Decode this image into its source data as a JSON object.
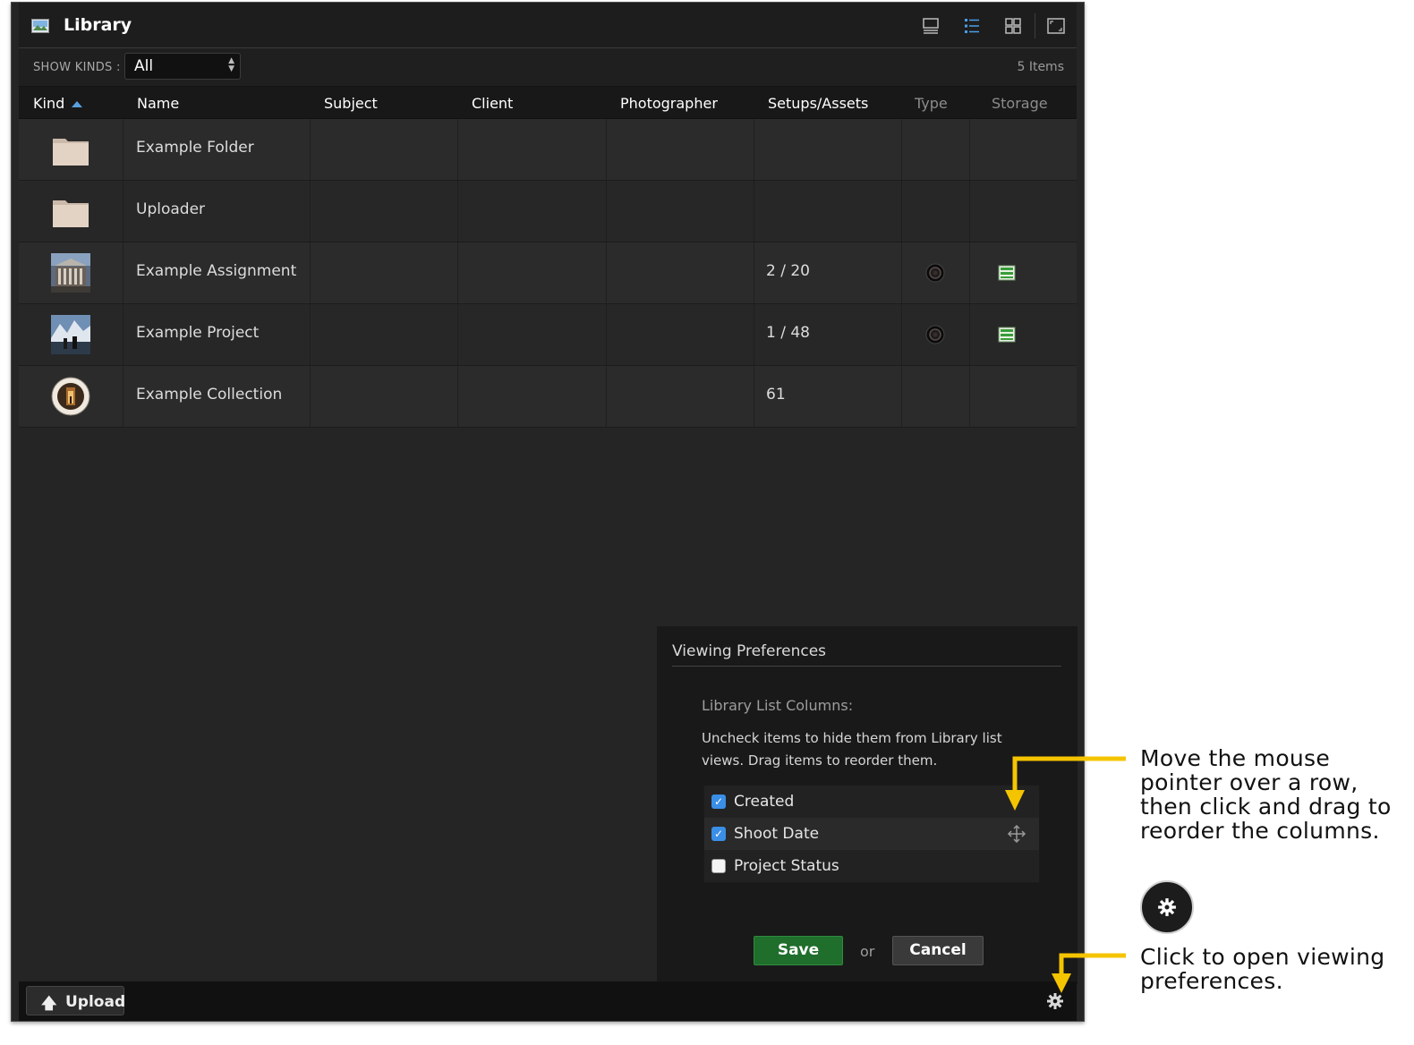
{
  "window": {
    "title": "Library",
    "view_buttons": [
      "detail-view-icon",
      "list-view-icon",
      "grid-view-icon",
      "fullscreen-icon"
    ],
    "active_view": "list-view-icon"
  },
  "filter": {
    "label": "SHOW KINDS :",
    "selected": "All",
    "count": "5 Items"
  },
  "columns": [
    {
      "label": "Kind",
      "sorted": "ascending"
    },
    {
      "label": "Name"
    },
    {
      "label": "Subject"
    },
    {
      "label": "Client"
    },
    {
      "label": "Photographer"
    },
    {
      "label": "Setups/Assets"
    },
    {
      "label": "Type",
      "dim": true
    },
    {
      "label": "Storage",
      "dim": true
    }
  ],
  "rows": [
    {
      "kind_icon": "folder-icon",
      "name": "Example Folder",
      "subject": "",
      "client": "",
      "photographer": "",
      "setups": "",
      "type_icon": "",
      "storage_icon": ""
    },
    {
      "kind_icon": "folder-icon",
      "name": "Uploader",
      "subject": "",
      "client": "",
      "photographer": "",
      "setups": "",
      "type_icon": "",
      "storage_icon": ""
    },
    {
      "kind_icon": "assignment-thumbnail-icon",
      "name": "Example Assignment",
      "subject": "",
      "client": "",
      "photographer": "",
      "setups": "2 / 20",
      "type_icon": "camera-lens-icon",
      "storage_icon": "storage-icon"
    },
    {
      "kind_icon": "project-thumbnail-icon",
      "name": "Example Project",
      "subject": "",
      "client": "",
      "photographer": "",
      "setups": "1 / 48",
      "type_icon": "camera-lens-icon",
      "storage_icon": "storage-icon"
    },
    {
      "kind_icon": "collection-thumbnail-icon",
      "name": "Example Collection",
      "subject": "",
      "client": "",
      "photographer": "",
      "setups": "61",
      "type_icon": "",
      "storage_icon": ""
    }
  ],
  "prefs": {
    "title": "Viewing Preferences",
    "section": "Library List Columns:",
    "description": "Uncheck items to hide them from Library list views. Drag items to reorder them.",
    "items": [
      {
        "label": "Created",
        "checked": true
      },
      {
        "label": "Shoot Date",
        "checked": true
      },
      {
        "label": "Project Status",
        "checked": false
      }
    ],
    "save": "Save",
    "or": "or",
    "cancel": "Cancel"
  },
  "bottom": {
    "upload": "Upload"
  },
  "annotations": {
    "drag_hint": [
      "Move the mouse",
      "pointer over a row,",
      "then click and drag to",
      "reorder the columns."
    ],
    "gear_hint": [
      "Click to open viewing",
      "preferences."
    ],
    "arrow_color": "#f5c400"
  }
}
